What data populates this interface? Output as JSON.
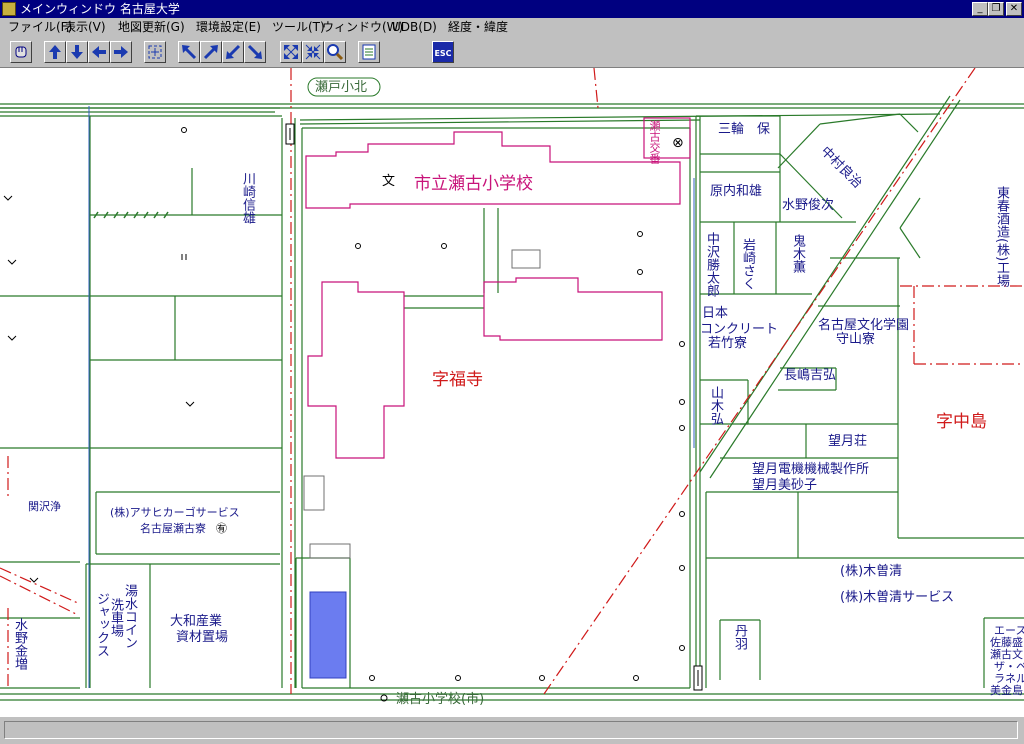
{
  "window": {
    "title": "メインウィンドウ 名古屋大学",
    "minimize": "_",
    "restore": "❐",
    "close": "✕"
  },
  "menu": [
    "ファイル(F)",
    "表示(V)",
    "地図更新(G)",
    "環境設定(E)",
    "ツール(T)",
    "ウィンドウ(W)",
    "UDB(D)",
    "経度・緯度"
  ],
  "toolbar": {
    "esc_label": "ESC"
  },
  "map": {
    "road_label_top": "瀬戸小北",
    "road_label_bottom": "瀬古小学校(市)",
    "school_name": "市立瀬古小学校",
    "school_symbol": "文",
    "place_fukuji": "字福寺",
    "place_nakajima": "字中島",
    "koban": "瀬古交番",
    "koban_symbol": "⊗",
    "labels": {
      "kawasaki_nobuyuki": "川崎信雄",
      "miwa_tamotsu": "三輪　保",
      "nakamura_yoshiharu": "中村良治",
      "harauchi_kazuo": "原内和雄",
      "mizuno_toshitsugu": "水野俊次",
      "nakazawa_katsutaro": "中沢勝太郎",
      "iwasaki_saku": "岩崎さく",
      "oniki_kaoru": "鬼木薫",
      "higashi_haru_brewery": "東春酒造(株)工場",
      "nihon_concrete_1": "日本",
      "nihon_concrete_2": "コンクリート",
      "nihon_concrete_3": "若竹寮",
      "nagoya_bunka_1": "名古屋文化学園",
      "nagoya_bunka_2": "守山寮",
      "nagasaki_yoshihiro": "長嶋吉弘",
      "yamaki_hiroshi": "山木弘",
      "mochizuki_sou": "望月荘",
      "mochizuki_kikai": "望月電機機械製作所",
      "mochizuki_misako": "望月美砂子",
      "kiso_sei": "(株)木曽清",
      "kiso_sei_service": "(株)木曽清サービス",
      "maruha": "丹羽",
      "asahi_cargo_1": "(株)アサヒカーゴサービス",
      "asahi_cargo_2": "名古屋瀬古寮",
      "asahi_cargo_mark": "㊒",
      "sekishita_kiyoshi": "関沢浄",
      "yusui_coin": "湯水コイン",
      "senshajo": "洗車場",
      "jackus": "ジャックス",
      "daiwa_1": "大和産業",
      "daiwa_2": "資材置場",
      "mizuno_kinzo": "水野金増",
      "ace_1": "エース",
      "ace_2": "佐藤盛",
      "ace_3": "瀬古文",
      "ace_4": "ザ・ベ",
      "ace_5": "ラネル",
      "ace_6": "美金島"
    }
  },
  "colors": {
    "road": "#2a7a2a",
    "school": "#c8137a",
    "boundary": "#d01a1a",
    "label": "#1a1a8a",
    "river": "#3060c0",
    "blue_rect": "#6b7cf0"
  }
}
